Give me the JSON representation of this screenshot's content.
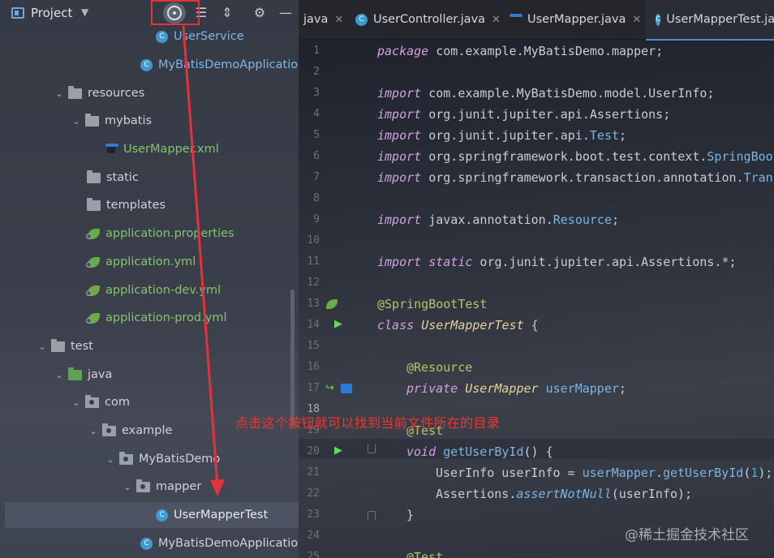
{
  "project_panel": {
    "title": "Project",
    "header_buttons": [
      "locate-icon",
      "expand-all-icon",
      "collapse-all-icon",
      "gear-icon",
      "minimize-icon"
    ],
    "tree": [
      {
        "label": "UserService",
        "type": "class",
        "color": "blue"
      },
      {
        "label": "MyBatisDemoApplication",
        "type": "spring-class",
        "color": "blue"
      },
      {
        "label": "resources",
        "type": "resources-folder",
        "expanded": true
      },
      {
        "label": "mybatis",
        "type": "folder",
        "expanded": true
      },
      {
        "label": "UserMapper.xml",
        "type": "mybatis-xml",
        "color": "green"
      },
      {
        "label": "static",
        "type": "folder"
      },
      {
        "label": "templates",
        "type": "folder"
      },
      {
        "label": "application.properties",
        "type": "spring-config",
        "color": "green"
      },
      {
        "label": "application.yml",
        "type": "spring-config",
        "color": "green"
      },
      {
        "label": "application-dev.yml",
        "type": "spring-config",
        "color": "green"
      },
      {
        "label": "application-prod.yml",
        "type": "spring-config",
        "color": "green"
      },
      {
        "label": "test",
        "type": "folder",
        "expanded": true
      },
      {
        "label": "java",
        "type": "test-source-folder",
        "expanded": true
      },
      {
        "label": "com",
        "type": "package",
        "expanded": true
      },
      {
        "label": "example",
        "type": "package",
        "expanded": true
      },
      {
        "label": "MyBatisDemo",
        "type": "package",
        "expanded": true
      },
      {
        "label": "mapper",
        "type": "package",
        "expanded": true
      },
      {
        "label": "UserMapperTest",
        "type": "class",
        "selected": true
      },
      {
        "label": "MyBatisDemoApplicationT",
        "type": "spring-class"
      }
    ]
  },
  "editor": {
    "tabs": [
      {
        "label": "java",
        "closable": true
      },
      {
        "label": "UserController.java",
        "closable": true
      },
      {
        "label": "UserMapper.java",
        "closable": true
      },
      {
        "label": "UserMapperTest.jav",
        "active": true
      }
    ],
    "lines": [
      {
        "num": "1",
        "text": "package com.example.MyBatisDemo.mapper;"
      },
      {
        "num": "2",
        "text": ""
      },
      {
        "num": "3",
        "text": "import com.example.MyBatisDemo.model.UserInfo;"
      },
      {
        "num": "4",
        "text": "import org.junit.jupiter.api.Assertions;"
      },
      {
        "num": "5",
        "text": "import org.junit.jupiter.api.Test;"
      },
      {
        "num": "6",
        "text": "import org.springframework.boot.test.context.SpringBoot"
      },
      {
        "num": "7",
        "text": "import org.springframework.transaction.annotation.Trans"
      },
      {
        "num": "8",
        "text": ""
      },
      {
        "num": "9",
        "text": "import javax.annotation.Resource;"
      },
      {
        "num": "10",
        "text": ""
      },
      {
        "num": "11",
        "text": "import static org.junit.jupiter.api.Assertions.*;"
      },
      {
        "num": "12",
        "text": ""
      },
      {
        "num": "13",
        "text": "@SpringBootTest"
      },
      {
        "num": "14",
        "text": "class UserMapperTest {"
      },
      {
        "num": "15",
        "text": ""
      },
      {
        "num": "16",
        "text": "@Resource"
      },
      {
        "num": "17",
        "text": "private UserMapper userMapper;"
      },
      {
        "num": "18",
        "text": ""
      },
      {
        "num": "19",
        "text": "@Test"
      },
      {
        "num": "20",
        "text": "void getUserById() {"
      },
      {
        "num": "21",
        "text": "UserInfo userInfo = userMapper.getUserById(1);"
      },
      {
        "num": "22",
        "text": "Assertions.assertNotNull(userInfo);"
      },
      {
        "num": "23",
        "text": "}"
      },
      {
        "num": "24",
        "text": ""
      },
      {
        "num": "25",
        "text": "@Test"
      }
    ]
  },
  "annotation": "点击这个按钮就可以找到当前文件所在的目录",
  "watermark": "@稀土掘金技术社区",
  "colors": {
    "annotation_red": "#e3323b",
    "selected_row": "#4d5363",
    "active_tab_underline": "#4a88c7"
  }
}
